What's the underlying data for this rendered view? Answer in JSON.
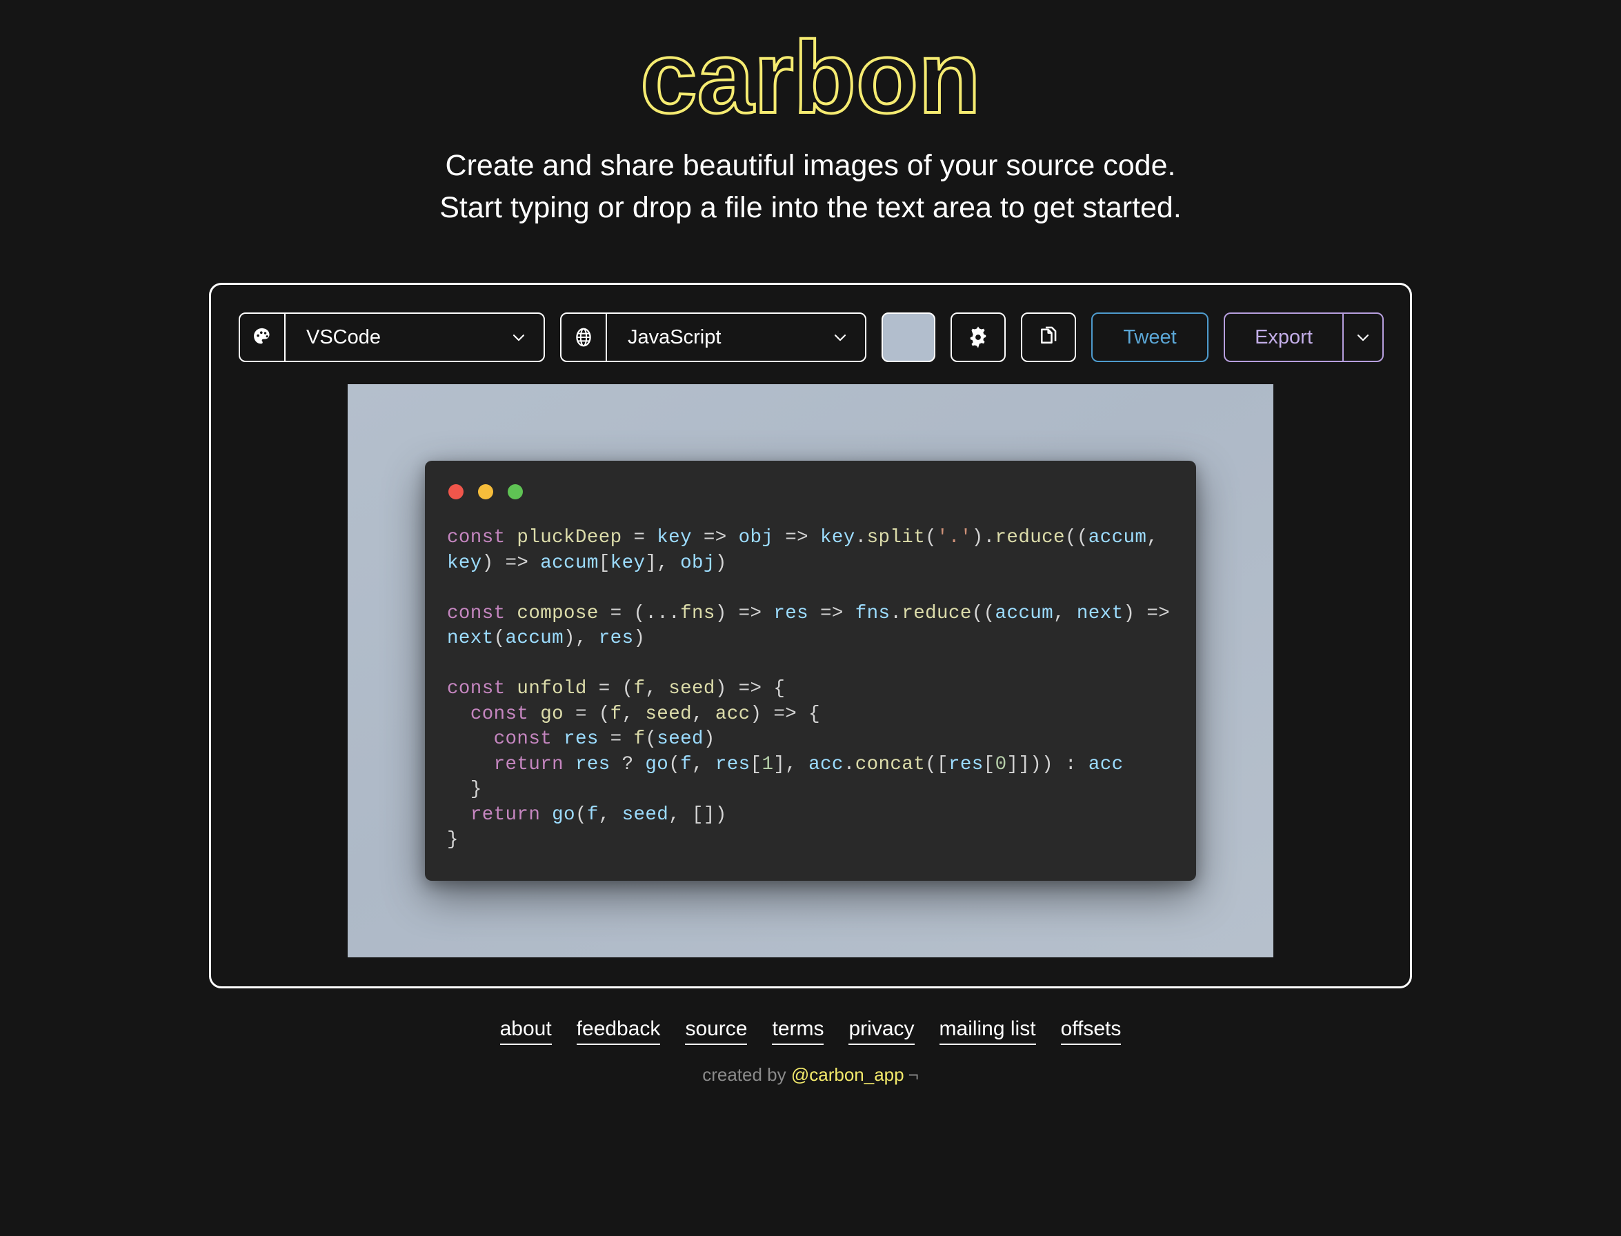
{
  "header": {
    "logo": "carbon",
    "logo_color": "#F5EB71",
    "tagline_line1": "Create and share beautiful images of your source code.",
    "tagline_line2": "Start typing or drop a file into the text area to get started."
  },
  "toolbar": {
    "theme": {
      "icon": "palette-icon",
      "value": "VSCode",
      "chevron": "chevron-down-icon"
    },
    "language": {
      "icon": "globe-icon",
      "value": "JavaScript",
      "chevron": "chevron-down-icon"
    },
    "background_swatch": {
      "icon": "color-swatch",
      "color": "#B2BECD"
    },
    "settings": {
      "icon": "gear-icon"
    },
    "copy": {
      "icon": "copy-files-icon"
    },
    "tweet": {
      "label": "Tweet",
      "color": "#5BA7D6"
    },
    "export": {
      "label": "Export",
      "color": "#C3AEE8",
      "chevron": "chevron-down-icon"
    }
  },
  "preview": {
    "background_color": "#B2BECD",
    "window": {
      "dots": [
        {
          "name": "close-dot",
          "color": "#F0564B"
        },
        {
          "name": "minimize-dot",
          "color": "#F6BD3B"
        },
        {
          "name": "zoom-dot",
          "color": "#5FC354"
        }
      ],
      "background_color": "#292929",
      "language": "JavaScript",
      "code_plain": "const pluckDeep = key => obj => key.split('.').reduce((accum, key) => accum[key], obj)\n\nconst compose = (...fns) => res => fns.reduce((accum, next) => next(accum), res)\n\nconst unfold = (f, seed) => {\n  const go = (f, seed, acc) => {\n    const res = f(seed)\n    return res ? go(f, res[1], acc.concat([res[0]])) : acc\n  }\n  return go(f, seed, [])\n}"
    }
  },
  "footer": {
    "links": [
      {
        "label": "about"
      },
      {
        "label": "feedback"
      },
      {
        "label": "source"
      },
      {
        "label": "terms"
      },
      {
        "label": "privacy"
      },
      {
        "label": "mailing list"
      },
      {
        "label": "offsets"
      }
    ],
    "credit_prefix": "created by ",
    "credit_handle": "@carbon_app",
    "credit_arrow": "¬"
  }
}
